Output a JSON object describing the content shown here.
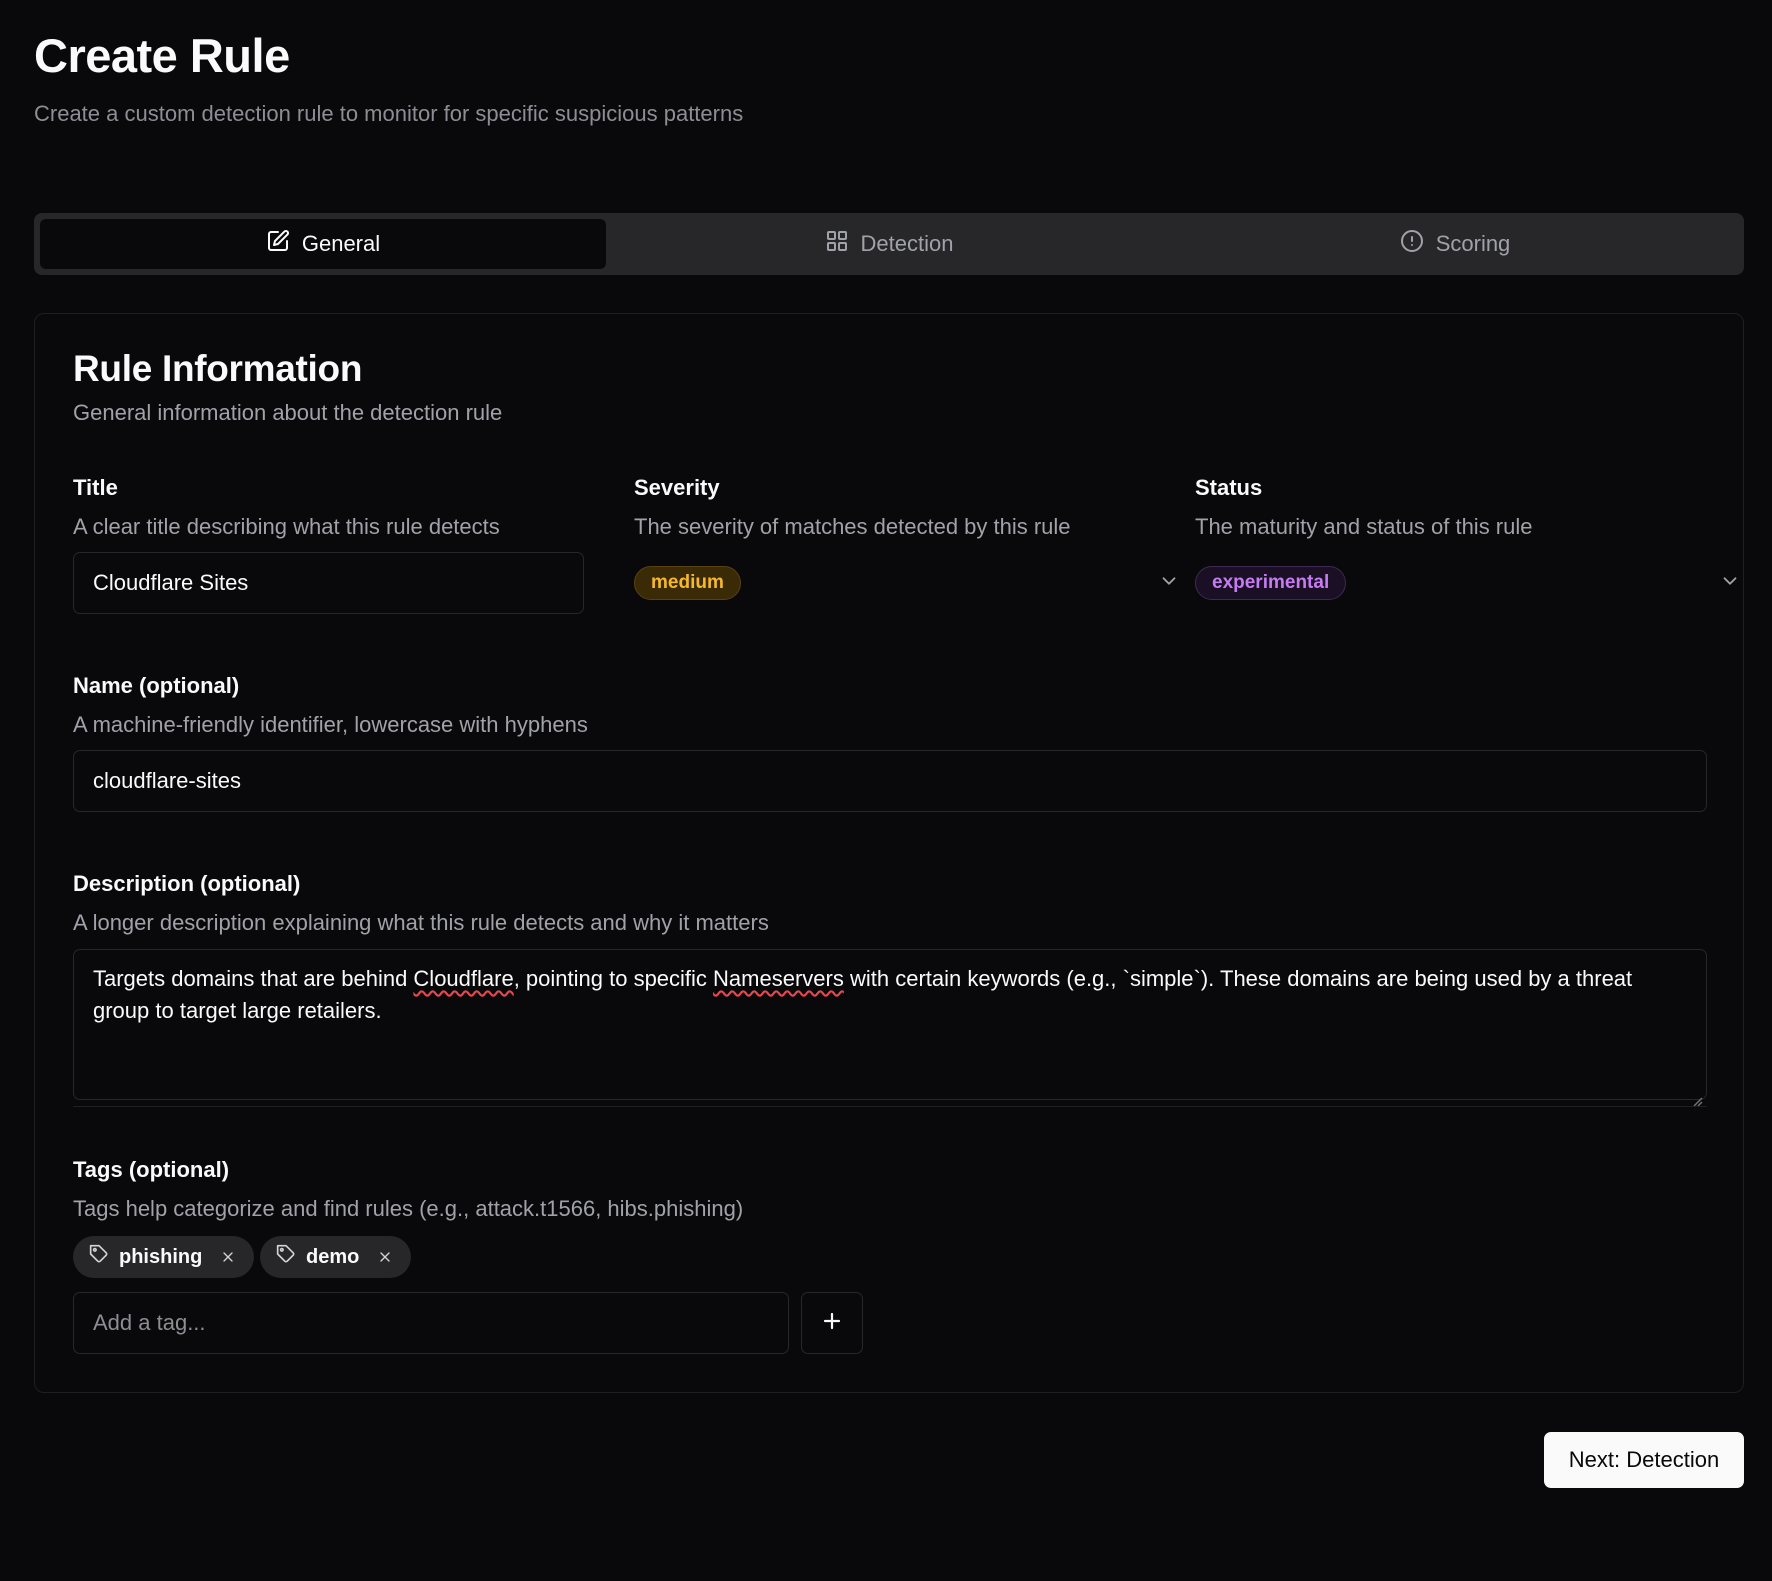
{
  "page": {
    "title": "Create Rule",
    "subtitle": "Create a custom detection rule to monitor for specific suspicious patterns"
  },
  "tabs": [
    {
      "label": "General",
      "icon": "edit-icon",
      "active": true
    },
    {
      "label": "Detection",
      "icon": "grid-icon",
      "active": false
    },
    {
      "label": "Scoring",
      "icon": "alert-circle-icon",
      "active": false
    }
  ],
  "card": {
    "title": "Rule Information",
    "description": "General information about the detection rule"
  },
  "fields": {
    "title": {
      "label": "Title",
      "help": "A clear title describing what this rule detects",
      "value": "Cloudflare Sites"
    },
    "severity": {
      "label": "Severity",
      "help": "The severity of matches detected by this rule",
      "value": "medium",
      "color": "#f5b82e"
    },
    "status": {
      "label": "Status",
      "help": "The maturity and status of this rule",
      "value": "experimental",
      "color": "#c47cf0"
    },
    "name": {
      "label": "Name (optional)",
      "help": "A machine-friendly identifier, lowercase with hyphens",
      "value": "cloudflare-sites"
    },
    "description": {
      "label": "Description (optional)",
      "help": "A longer description explaining what this rule detects and why it matters",
      "text_1": "Targets domains that are behind ",
      "spell_1": "Cloudflare",
      "text_2": ", pointing to specific ",
      "spell_2": "Nameservers",
      "text_3": " with certain keywords (e.g., `simple`). These domains are being used by a threat group to target large retailers."
    },
    "tags": {
      "label": "Tags (optional)",
      "help": "Tags help categorize and find rules (e.g., attack.t1566, hibs.phishing)",
      "items": [
        {
          "label": "phishing"
        },
        {
          "label": "demo"
        }
      ],
      "placeholder": "Add a tag..."
    }
  },
  "actions": {
    "next_label": "Next: Detection"
  }
}
